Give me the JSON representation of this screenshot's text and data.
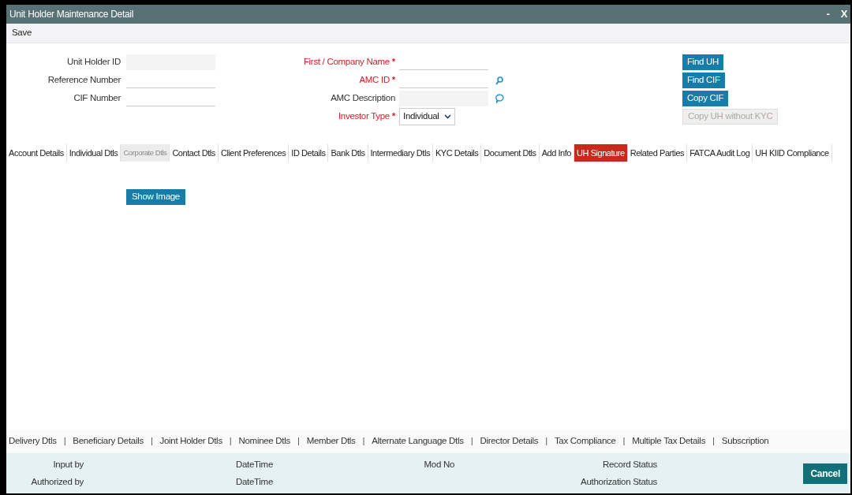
{
  "window": {
    "title": "Unit Holder Maintenance Detail",
    "controls": [
      "-",
      "X"
    ]
  },
  "toolbar": {
    "actions": [
      "Save"
    ]
  },
  "form": {
    "required_mark": "*",
    "left_fields": [
      {
        "label": "Unit Holder ID",
        "required": false,
        "disabled": true
      },
      {
        "label": "Reference Number",
        "required": false,
        "disabled": false
      },
      {
        "label": "CIF Number",
        "required": false,
        "disabled": false
      }
    ],
    "middle_fields": [
      {
        "label": "First / Company Name",
        "required": true,
        "kind": "text",
        "disabled": false
      },
      {
        "label": "AMC ID",
        "required": true,
        "kind": "search",
        "disabled": false
      },
      {
        "label": "AMC Description",
        "required": false,
        "kind": "lookup",
        "disabled": true
      },
      {
        "label": "Investor Type",
        "required": true,
        "kind": "select",
        "value": "Individual"
      }
    ],
    "buttons": [
      {
        "label": "Find UH",
        "disabled": false
      },
      {
        "label": "Find CIF",
        "disabled": false
      },
      {
        "label": "Copy CIF",
        "disabled": false
      },
      {
        "label": "Copy UH without KYC",
        "disabled": true
      }
    ]
  },
  "tabs": [
    {
      "label": "Account Details",
      "selected": false,
      "disabled": false
    },
    {
      "label": "Individual Dtls",
      "selected": false,
      "disabled": false
    },
    {
      "label": "Corporate Dtls",
      "selected": false,
      "disabled": true
    },
    {
      "label": "Contact Dtls",
      "selected": false,
      "disabled": false
    },
    {
      "label": "Client Preferences",
      "selected": false,
      "disabled": false
    },
    {
      "label": "ID Details",
      "selected": false,
      "disabled": false
    },
    {
      "label": "Bank Dtls",
      "selected": false,
      "disabled": false
    },
    {
      "label": "Intermediary Dtls",
      "selected": false,
      "disabled": false
    },
    {
      "label": "KYC Details",
      "selected": false,
      "disabled": false
    },
    {
      "label": "Document Dtls",
      "selected": false,
      "disabled": false
    },
    {
      "label": "Add Info",
      "selected": false,
      "disabled": false
    },
    {
      "label": "UH Signature",
      "selected": true,
      "disabled": false
    },
    {
      "label": "Related Parties",
      "selected": false,
      "disabled": false
    },
    {
      "label": "FATCA Audit Log",
      "selected": false,
      "disabled": false
    },
    {
      "label": "UH KIID Compliance",
      "selected": false,
      "disabled": false
    }
  ],
  "tab_content": {
    "buttons": [
      "Show Image"
    ]
  },
  "sub_links": {
    "items": [
      "Delivery Dtls",
      "Beneficiary Details",
      "Joint Holder Dtls",
      "Nominee Dtls",
      "Member Dtls",
      "Alternate Language Dtls",
      "Director Details",
      "Tax Compliance",
      "Multiple Tax Details",
      "Subscription"
    ],
    "separator": "|"
  },
  "audit": {
    "rows": [
      [
        "Input by",
        "DateTime",
        "Mod No",
        "Record Status"
      ],
      [
        "Authorized by",
        "DateTime",
        "",
        "Authorization Status"
      ]
    ]
  },
  "footer_buttons": [
    "Cancel"
  ]
}
